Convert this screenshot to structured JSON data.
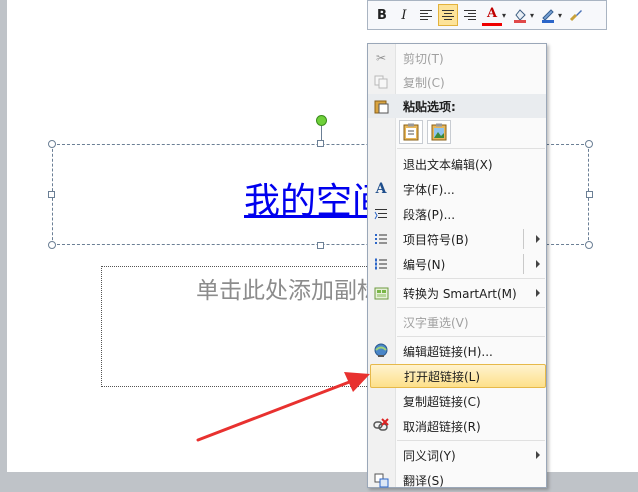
{
  "slide": {
    "title_text": "我的空间",
    "subtitle_placeholder": "单击此处添加副标题"
  },
  "toolbar": {
    "bold": "B",
    "italic": "I",
    "font_color": "A"
  },
  "context_menu": {
    "items": [
      {
        "label": "剪切(T)",
        "icon": "scissors-icon",
        "disabled": true
      },
      {
        "label": "复制(C)",
        "icon": "copy-icon",
        "disabled": true
      },
      {
        "label": "粘贴选项:",
        "icon": "paste-icon",
        "bold": true
      },
      {
        "label": "退出文本编辑(X)"
      },
      {
        "label": "字体(F)...",
        "icon": "font-icon"
      },
      {
        "label": "段落(P)...",
        "icon": "paragraph-icon"
      },
      {
        "label": "项目符号(B)",
        "icon": "bullets-icon",
        "submenu": true
      },
      {
        "label": "编号(N)",
        "icon": "numbering-icon",
        "submenu": true
      },
      {
        "label": "转换为 SmartArt(M)",
        "icon": "smartart-icon",
        "submenu": true
      },
      {
        "label": "汉字重选(V)",
        "disabled": true
      },
      {
        "label": "编辑超链接(H)...",
        "icon": "hyperlink-icon"
      },
      {
        "label": "打开超链接(L)",
        "highlighted": true
      },
      {
        "label": "复制超链接(C)"
      },
      {
        "label": "取消超链接(R)",
        "icon": "remove-link-icon"
      },
      {
        "label": "同义词(Y)",
        "submenu": true
      },
      {
        "label": "翻译(S)",
        "icon": "translate-icon"
      }
    ]
  },
  "colors": {
    "highlight": "#fde08a",
    "arrow": "#e8312f",
    "link": "#0000ee"
  }
}
